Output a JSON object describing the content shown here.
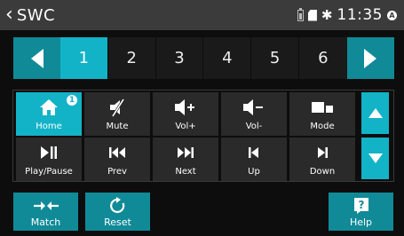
{
  "status_bar": {
    "title": "SWC",
    "time": "11:35",
    "bluetooth_glyph": "✱",
    "badge_letter": "A",
    "icons": [
      "battery-icon",
      "sd-card-icon",
      "bluetooth-icon",
      "notification-icon"
    ]
  },
  "pages": {
    "items": [
      "1",
      "2",
      "3",
      "4",
      "5",
      "6"
    ],
    "selected": "1"
  },
  "keys": {
    "home": {
      "label": "Home",
      "badge": "1"
    },
    "mute": {
      "label": "Mute"
    },
    "vol_up": {
      "label": "Vol+"
    },
    "vol_down": {
      "label": "Vol-"
    },
    "mode": {
      "label": "Mode"
    },
    "play_pause": {
      "label": "Play/Pause"
    },
    "prev": {
      "label": "Prev"
    },
    "next": {
      "label": "Next"
    },
    "up": {
      "label": "Up"
    },
    "down": {
      "label": "Down"
    }
  },
  "actions": {
    "match": {
      "label": "Match"
    },
    "reset": {
      "label": "Reset"
    },
    "help": {
      "label": "Help",
      "glyph": "?"
    }
  },
  "colors": {
    "accent": "#12b3c7",
    "accent_dark": "#108a97",
    "key_bg": "#2a2a2a",
    "status_bg": "#3b3b3b"
  }
}
